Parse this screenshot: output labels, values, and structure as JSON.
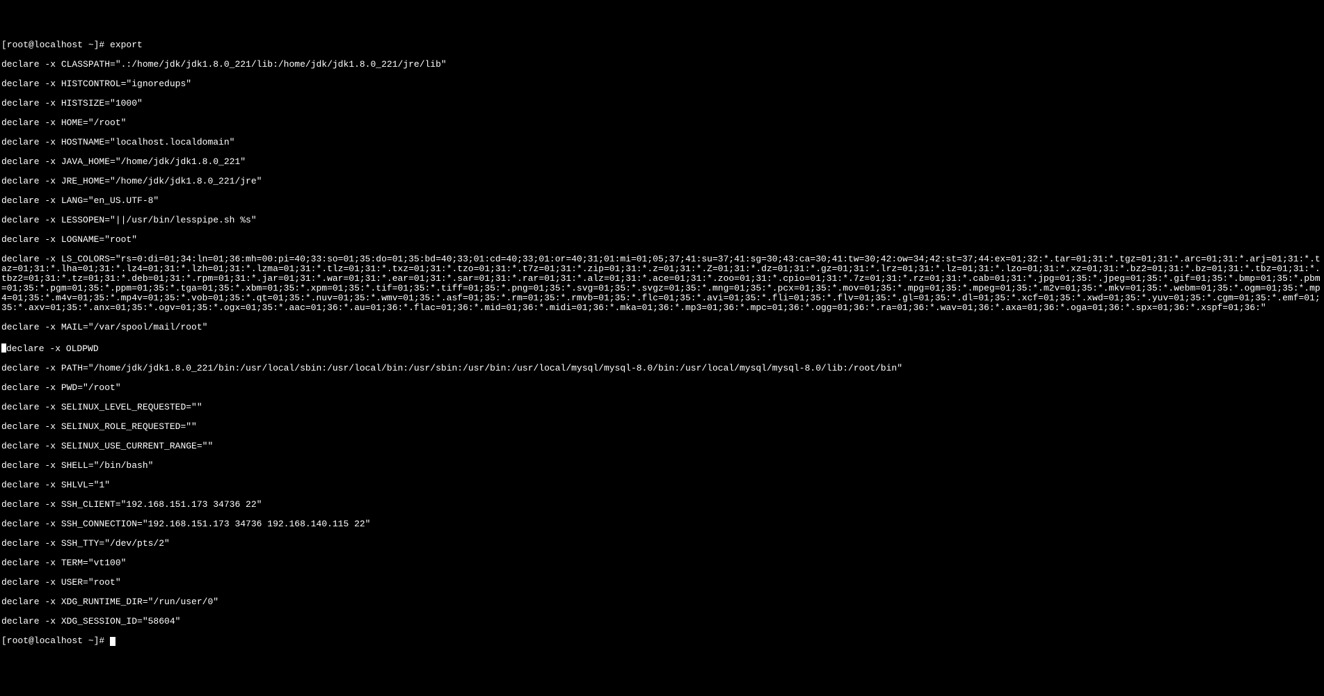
{
  "prompt1": "[root@localhost ~]# export",
  "env": {
    "CLASSPATH": "declare -x CLASSPATH=\".:/home/jdk/jdk1.8.0_221/lib:/home/jdk/jdk1.8.0_221/jre/lib\"",
    "HISTCONTROL": "declare -x HISTCONTROL=\"ignoredups\"",
    "HISTSIZE": "declare -x HISTSIZE=\"1000\"",
    "HOME": "declare -x HOME=\"/root\"",
    "HOSTNAME": "declare -x HOSTNAME=\"localhost.localdomain\"",
    "JAVA_HOME": "declare -x JAVA_HOME=\"/home/jdk/jdk1.8.0_221\"",
    "JRE_HOME": "declare -x JRE_HOME=\"/home/jdk/jdk1.8.0_221/jre\"",
    "LANG": "declare -x LANG=\"en_US.UTF-8\"",
    "LESSOPEN": "declare -x LESSOPEN=\"||/usr/bin/lesspipe.sh %s\"",
    "LOGNAME": "declare -x LOGNAME=\"root\"",
    "LS_COLORS": "declare -x LS_COLORS=\"rs=0:di=01;34:ln=01;36:mh=00:pi=40;33:so=01;35:do=01;35:bd=40;33;01:cd=40;33;01:or=40;31;01:mi=01;05;37;41:su=37;41:sg=30;43:ca=30;41:tw=30;42:ow=34;42:st=37;44:ex=01;32:*.tar=01;31:*.tgz=01;31:*.arc=01;31:*.arj=01;31:*.taz=01;31:*.lha=01;31:*.lz4=01;31:*.lzh=01;31:*.lzma=01;31:*.tlz=01;31:*.txz=01;31:*.tzo=01;31:*.t7z=01;31:*.zip=01;31:*.z=01;31:*.Z=01;31:*.dz=01;31:*.gz=01;31:*.lrz=01;31:*.lz=01;31:*.lzo=01;31:*.xz=01;31:*.bz2=01;31:*.bz=01;31:*.tbz=01;31:*.tbz2=01;31:*.tz=01;31:*.deb=01;31:*.rpm=01;31:*.jar=01;31:*.war=01;31:*.ear=01;31:*.sar=01;31:*.rar=01;31:*.alz=01;31:*.ace=01;31:*.zoo=01;31:*.cpio=01;31:*.7z=01;31:*.rz=01;31:*.cab=01;31:*.jpg=01;35:*.jpeg=01;35:*.gif=01;35:*.bmp=01;35:*.pbm=01;35:*.pgm=01;35:*.ppm=01;35:*.tga=01;35:*.xbm=01;35:*.xpm=01;35:*.tif=01;35:*.tiff=01;35:*.png=01;35:*.svg=01;35:*.svgz=01;35:*.mng=01;35:*.pcx=01;35:*.mov=01;35:*.mpg=01;35:*.mpeg=01;35:*.m2v=01;35:*.mkv=01;35:*.webm=01;35:*.ogm=01;35:*.mp4=01;35:*.m4v=01;35:*.mp4v=01;35:*.vob=01;35:*.qt=01;35:*.nuv=01;35:*.wmv=01;35:*.asf=01;35:*.rm=01;35:*.rmvb=01;35:*.flc=01;35:*.avi=01;35:*.fli=01;35:*.flv=01;35:*.gl=01;35:*.dl=01;35:*.xcf=01;35:*.xwd=01;35:*.yuv=01;35:*.cgm=01;35:*.emf=01;35:*.axv=01;35:*.anx=01;35:*.ogv=01;35:*.ogx=01;35:*.aac=01;36:*.au=01;36:*.flac=01;36:*.mid=01;36:*.midi=01;36:*.mka=01;36:*.mp3=01;36:*.mpc=01;36:*.ogg=01;36:*.ra=01;36:*.wav=01;36:*.axa=01;36:*.oga=01;36:*.spx=01;36:*.xspf=01;36:\"",
    "MAIL": "declare -x MAIL=\"/var/spool/mail/root\"",
    "OLDPWD": "declare -x OLDPWD",
    "PATH": "declare -x PATH=\"/home/jdk/jdk1.8.0_221/bin:/usr/local/sbin:/usr/local/bin:/usr/sbin:/usr/bin:/usr/local/mysql/mysql-8.0/bin:/usr/local/mysql/mysql-8.0/lib:/root/bin\"",
    "PWD": "declare -x PWD=\"/root\"",
    "SELINUX_LEVEL_REQUESTED": "declare -x SELINUX_LEVEL_REQUESTED=\"\"",
    "SELINUX_ROLE_REQUESTED": "declare -x SELINUX_ROLE_REQUESTED=\"\"",
    "SELINUX_USE_CURRENT_RANGE": "declare -x SELINUX_USE_CURRENT_RANGE=\"\"",
    "SHELL": "declare -x SHELL=\"/bin/bash\"",
    "SHLVL": "declare -x SHLVL=\"1\"",
    "SSH_CLIENT": "declare -x SSH_CLIENT=\"192.168.151.173 34736 22\"",
    "SSH_CONNECTION": "declare -x SSH_CONNECTION=\"192.168.151.173 34736 192.168.140.115 22\"",
    "SSH_TTY": "declare -x SSH_TTY=\"/dev/pts/2\"",
    "TERM": "declare -x TERM=\"vt100\"",
    "USER": "declare -x USER=\"root\"",
    "XDG_RUNTIME_DIR": "declare -x XDG_RUNTIME_DIR=\"/run/user/0\"",
    "XDG_SESSION_ID": "declare -x XDG_SESSION_ID=\"58604\""
  },
  "prompt2": "[root@localhost ~]# "
}
